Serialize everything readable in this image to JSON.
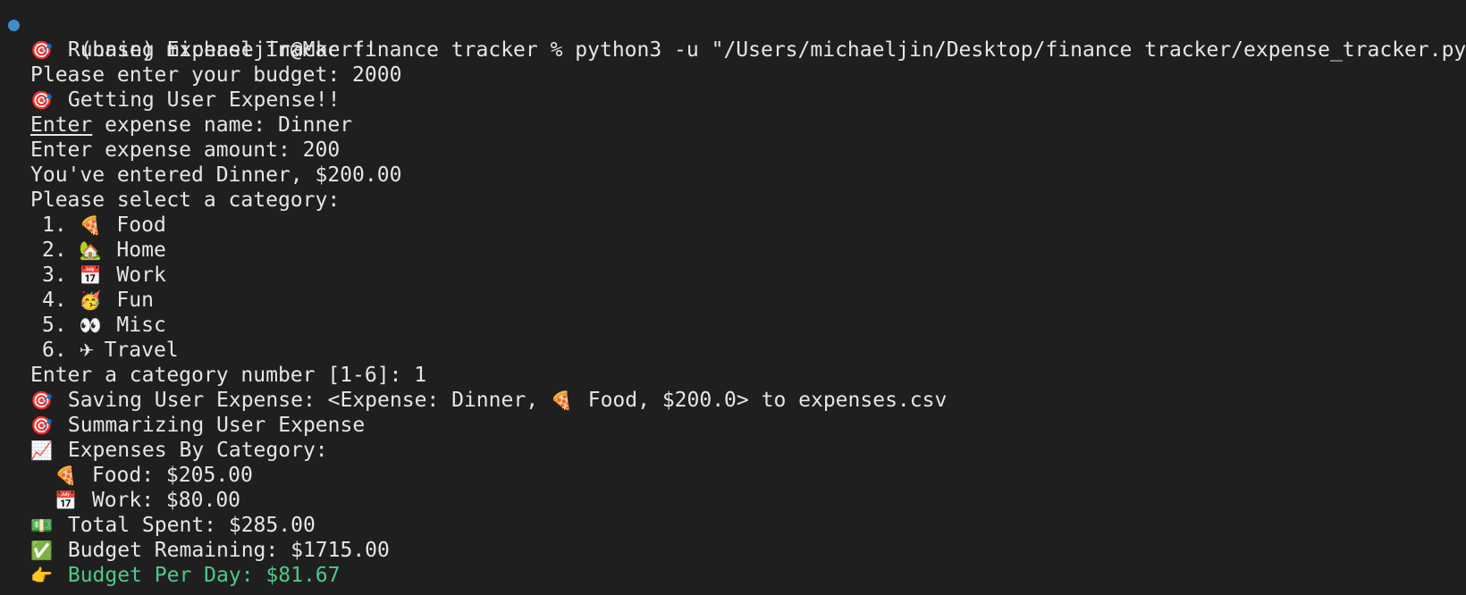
{
  "prompt": {
    "text": "(base) michaeljin@Mac finance tracker % python3 -u \"/Users/michaeljin/Desktop/finance tracker/expense_tracker.py\""
  },
  "lines": {
    "running": {
      "icon": "🎯",
      "text": " Running Expense Tracker!!"
    },
    "budget": "Please enter your budget: 2000",
    "getting": {
      "icon": "🎯",
      "text": " Getting User Expense!!"
    },
    "name_enter": "Enter",
    "name_rest": " expense name: Dinner",
    "amount": "Enter expense amount: 200",
    "entered": "You've entered Dinner, $200.00",
    "select": "Please select a category:",
    "categories": [
      {
        "num": "1.",
        "icon": "🍕",
        "label": " Food"
      },
      {
        "num": "2.",
        "icon": "🏡",
        "label": " Home"
      },
      {
        "num": "3.",
        "icon": "📅",
        "label": " Work"
      },
      {
        "num": "4.",
        "icon": "🥳",
        "label": " Fun"
      },
      {
        "num": "5.",
        "icon": "👀",
        "label": " Misc"
      },
      {
        "num": "6.",
        "icon": "✈",
        "label": "Travel"
      }
    ],
    "category_number": "Enter a category number [1-6]: 1",
    "saving": {
      "icon": "🎯",
      "text_a": " Saving User Expense: <Expense: Dinner, ",
      "icon2": "🍕",
      "text_b": " Food, $200.0> to expenses.csv"
    },
    "summarizing": {
      "icon": "🎯",
      "text": " Summarizing User Expense"
    },
    "by_category": {
      "icon": "📈",
      "text": " Expenses By Category:"
    },
    "summary": [
      {
        "icon": "🍕",
        "text": " Food: $205.00"
      },
      {
        "icon": "📅",
        "text": " Work: $80.00"
      }
    ],
    "total": {
      "icon": "💵",
      "text": " Total Spent: $285.00"
    },
    "remaining": {
      "icon": "✅",
      "text": " Budget Remaining: $1715.00"
    },
    "per_day": {
      "icon": "👉",
      "text": " Budget Per Day: $81.67"
    }
  },
  "colors": {
    "background": "#1f1f1f",
    "text": "#e6e6e6",
    "accent_green": "#4ec98a",
    "status_dot": "#3f8fc6"
  },
  "icons": {
    "status": "status-dot-icon"
  }
}
